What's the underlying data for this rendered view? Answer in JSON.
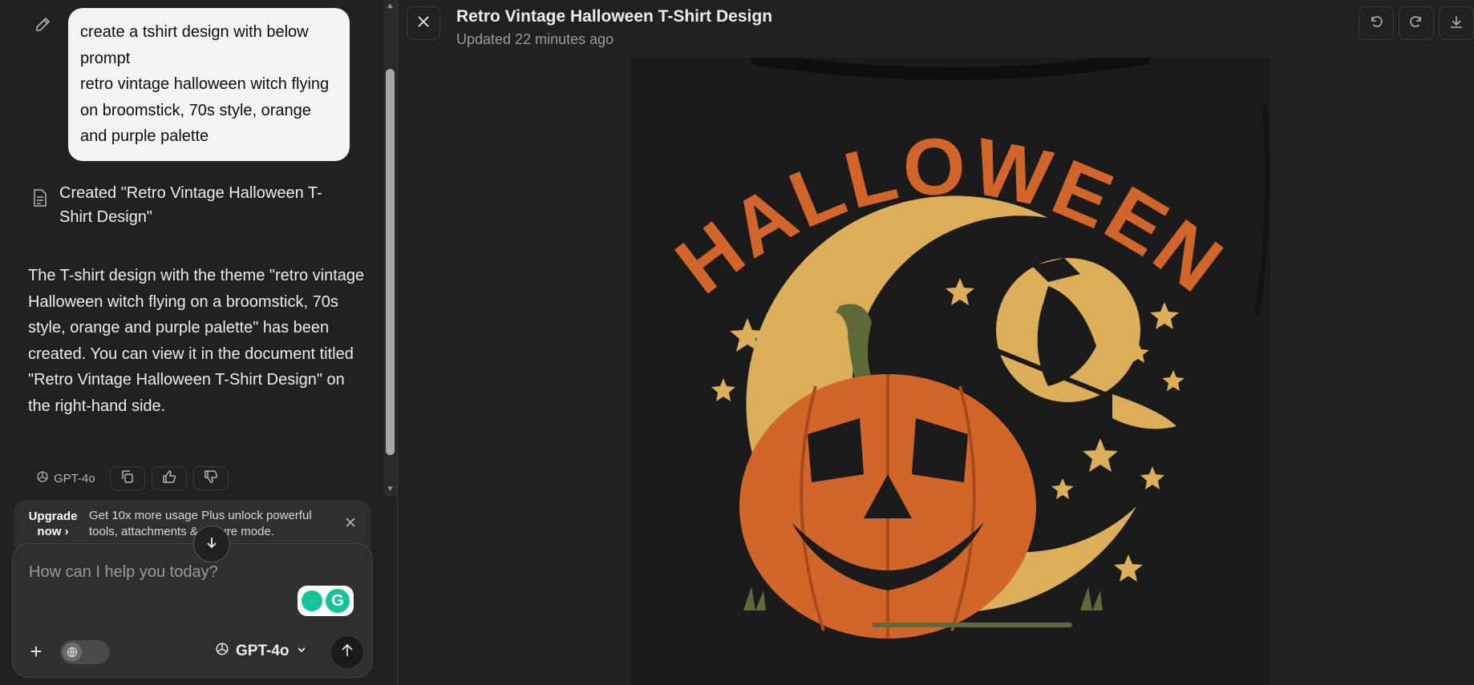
{
  "chat": {
    "user_message": "create a tshirt design with below prompt\nretro vintage halloween witch flying on broomstick, 70s style, orange and purple palette",
    "doc_chip_label": "Created \"Retro Vintage Halloween T-Shirt Design\"",
    "assistant_message": "The T-shirt design with the theme \"retro vintage Halloween witch flying on a broomstick, 70s style, orange and purple palette\" has been created. You can view it in the document titled \"Retro Vintage Halloween T-Shirt Design\" on the right-hand side.",
    "model_chip": "GPT-4o"
  },
  "upgrade": {
    "title_line1": "Upgrade",
    "title_line2": "now ›",
    "text": "Get 10x more usage Plus unlock powerful tools, attachments & secure mode."
  },
  "composer": {
    "placeholder": "How can I help you today?",
    "model_label": "GPT-4o"
  },
  "canvas": {
    "title": "Retro Vintage Halloween T-Shirt Design",
    "updated": "Updated 22 minutes ago",
    "artwork_text": "HALLOWEEN"
  },
  "colors": {
    "orange": "#d2652a",
    "moon": "#dcae5a",
    "stem": "#5f6a3a",
    "shirt": "#1b1b1b"
  }
}
